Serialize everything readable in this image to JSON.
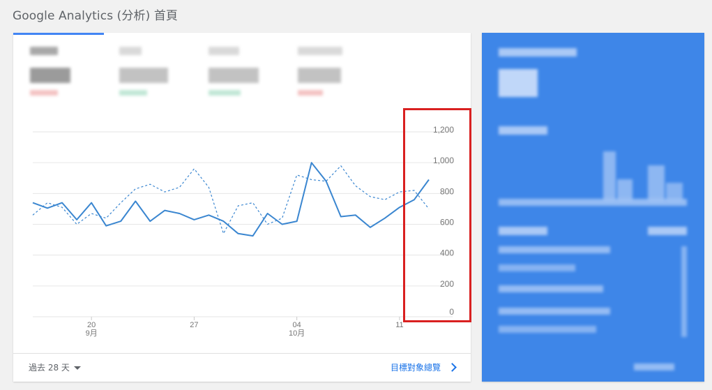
{
  "page": {
    "title": "Google Analytics (分析) 首頁"
  },
  "footer": {
    "range_label": "過去 28 天",
    "audience_link": "目標對象總覽"
  },
  "colors": {
    "accent": "#4285f4",
    "line_current": "#3a86d0",
    "line_previous": "#3a86d0",
    "highlight": "#d92020",
    "realtime_bg": "#3e86e8"
  },
  "icons": {
    "range_dropdown": "chevron-down-icon",
    "audience_link": "chevron-right-icon"
  },
  "chart_data": {
    "type": "line",
    "y_axis_position": "right",
    "yticks": [
      "1,200",
      "1,000",
      "800",
      "600",
      "400",
      "200",
      "0"
    ],
    "ylim": [
      0,
      1200
    ],
    "xticks": [
      {
        "index": 4,
        "day": "20",
        "month": "9月"
      },
      {
        "index": 11,
        "day": "27",
        "month": ""
      },
      {
        "index": 18,
        "day": "04",
        "month": "10月"
      },
      {
        "index": 25,
        "day": "11",
        "month": ""
      }
    ],
    "series": [
      {
        "style": "solid",
        "values": [
          740,
          705,
          740,
          630,
          740,
          590,
          620,
          750,
          620,
          690,
          670,
          630,
          660,
          620,
          540,
          525,
          670,
          600,
          620,
          1000,
          880,
          650,
          660,
          580,
          640,
          710,
          760,
          890
        ]
      },
      {
        "style": "dashed",
        "values": [
          660,
          740,
          710,
          600,
          670,
          640,
          740,
          830,
          860,
          810,
          840,
          960,
          840,
          540,
          720,
          740,
          600,
          640,
          920,
          890,
          880,
          980,
          850,
          780,
          760,
          810,
          820,
          700
        ]
      }
    ]
  }
}
